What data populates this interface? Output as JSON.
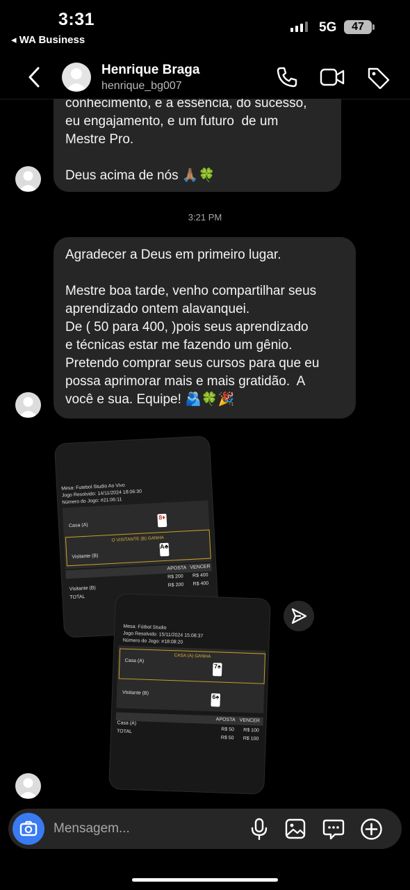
{
  "status_bar": {
    "time": "3:31",
    "back_app": "◂ WA Business",
    "network": "5G",
    "battery": "47"
  },
  "header": {
    "name": "Henrique Braga",
    "username": "henrique_bg007"
  },
  "messages": [
    {
      "text": "conhecimento, e a essência, do sucesso,\neu engajamento, e um futuro  de um\nMestre Pro.\n\nDeus acima de nós 🙏🏽🍀"
    },
    {
      "text": "Agradecer a Deus em primeiro lugar.\n\nMestre boa tarde, venho compartilhar seus\naprendizado ontem alavanquei.\nDe ( 50 para 400, )pois seus aprendizado\ne técnicas estar me fazendo um gênio.\nPretendo comprar seus cursos para que eu\npossa aprimorar mais e mais gratidão.  A\nvocê e sua. Equipe! 🫂🍀🎉"
    }
  ],
  "timestamp": "3:21 PM",
  "receipts": [
    {
      "mesa": "Mesa: Futebol Studio Ao Vivo",
      "jogo_resolvido": "Jogo Resolvido: 14/11/2024 18:06:30",
      "numero": "Número do Jogo: #21:06:11",
      "home_label": "Casa (A)",
      "home_card": "8♦",
      "away_label": "Visitante (B)",
      "away_card": "A♣",
      "banner": "O VISITANTE (B) GANHA",
      "col_aposta": "APOSTA",
      "col_vencer": "VENCER",
      "bet_row_label": "Visitante (B)",
      "bet_aposta": "R$ 200",
      "bet_vencer": "R$ 400",
      "total_label": "TOTAL",
      "total_aposta": "R$ 200",
      "total_vencer": "R$ 400"
    },
    {
      "mesa": "Mesa: Fútbol Studio",
      "jogo_resolvido": "Jogo Resolvido: 15/11/2024 15:08:37",
      "numero": "Número do Jogo: #18:08:20",
      "home_label": "Casa (A)",
      "home_card": "7♠",
      "away_label": "Visitante (B)",
      "away_card": "6♠",
      "banner": "CASA (A) GANHA",
      "col_aposta": "APOSTA",
      "col_vencer": "VENCER",
      "bet_row_label": "Casa (A)",
      "bet_aposta": "R$ 50",
      "bet_vencer": "R$ 100",
      "total_label": "TOTAL",
      "total_aposta": "R$ 50",
      "total_vencer": "R$ 100"
    }
  ],
  "composer": {
    "placeholder": "Mensagem..."
  },
  "colors": {
    "background": "#000000",
    "bubble": "#262626",
    "camera_button": "#3a7bf2",
    "gold_banner": "#c9a227"
  },
  "icons": [
    "back-chevron-icon",
    "phone-icon",
    "video-icon",
    "tag-icon",
    "send-icon",
    "camera-icon",
    "microphone-icon",
    "gallery-icon",
    "sticker-icon",
    "plus-icon"
  ]
}
